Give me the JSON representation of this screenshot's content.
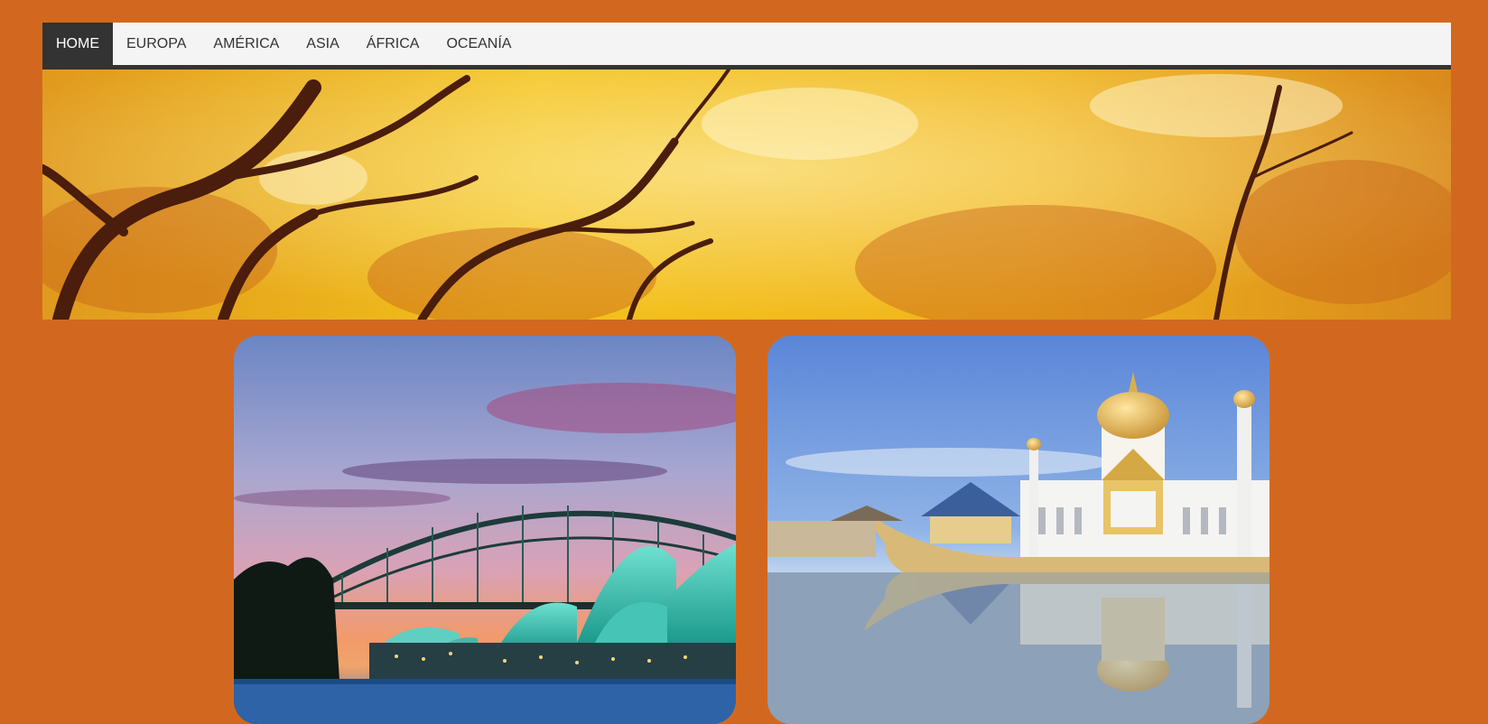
{
  "nav": {
    "items": [
      {
        "label": "HOME",
        "active": true
      },
      {
        "label": "EUROPA",
        "active": false
      },
      {
        "label": "AMÉRICA",
        "active": false
      },
      {
        "label": "ASIA",
        "active": false
      },
      {
        "label": "ÁFRICA",
        "active": false
      },
      {
        "label": "OCEANÍA",
        "active": false
      }
    ]
  },
  "colors": {
    "page_background": "#d2681f",
    "nav_background": "#f4f4f4",
    "nav_active": "#333333",
    "nav_text": "#333333"
  },
  "images": {
    "banner": "autumn-trees-banner",
    "card_left": "sydney-harbour-bridge-opera-house",
    "card_right": "mosque-reflection-water"
  }
}
